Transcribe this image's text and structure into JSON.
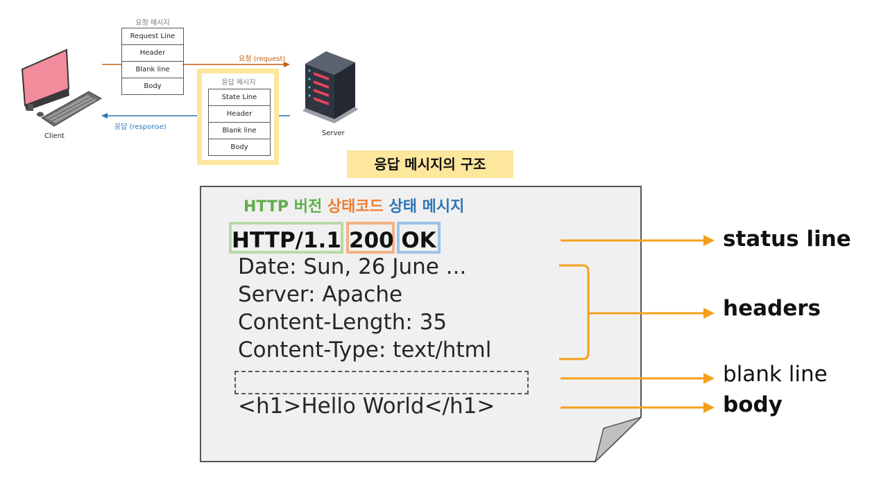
{
  "top_diagram": {
    "request_stack": {
      "title": "요청 메시지",
      "rows": [
        "Request Line",
        "Header",
        "Blank line",
        "Body"
      ]
    },
    "response_stack": {
      "title": "응답 메시지",
      "rows": [
        "State Line",
        "Header",
        "Blank line",
        "Body"
      ]
    },
    "request_arrow_label": "요청 (request)",
    "response_arrow_label": "응답 (response)",
    "client_label": "Client",
    "server_label": "Server"
  },
  "title": "응답 메시지의 구조",
  "legend": {
    "http_version": "HTTP 버전",
    "status_code": "상태코드",
    "status_message": "상태 메시지"
  },
  "status_line": {
    "version": "HTTP/1.1",
    "code": "200",
    "message": "OK"
  },
  "headers": [
    "Date: Sun, 26 June ...",
    "Server: Apache",
    "Content-Length: 35",
    "Content-Type: text/html"
  ],
  "body_text": "<h1>Hello World</h1>",
  "right_labels": {
    "status_line": "status line",
    "headers": "headers",
    "blank_line": "blank line",
    "body": "body"
  },
  "colors": {
    "highlight_yellow": "#fde79c",
    "version_green": "#5fae4a",
    "version_box": "#b8d9a7",
    "code_orange": "#ed7d31",
    "code_box": "#f4b183",
    "message_blue": "#2e75b6",
    "message_box": "#9dc3e6",
    "arrow_orange": "#f5a01a",
    "request_arrow": "#c55a11",
    "response_arrow": "#2e75b6",
    "document_fill": "#f0f0f0",
    "monitor_screen": "#f28c9c"
  }
}
